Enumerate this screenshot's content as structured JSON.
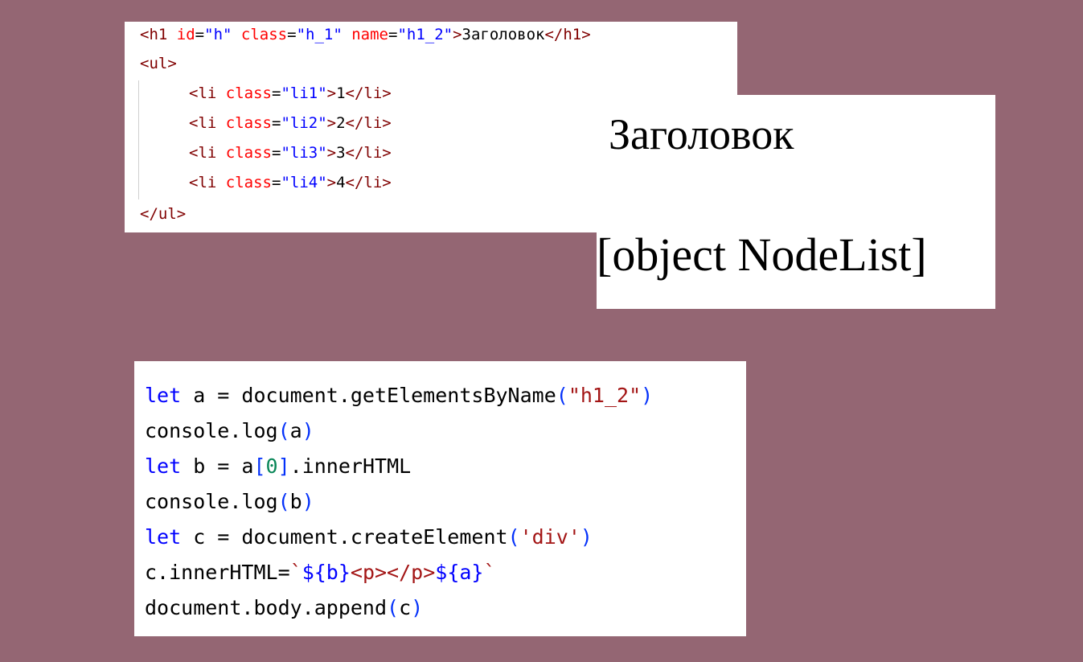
{
  "html_code": {
    "line1": {
      "open": "<h1",
      "attr_id": "id",
      "val_id": "\"h\"",
      "attr_class": "class",
      "val_class": "\"h_1\"",
      "attr_name": "name",
      "val_name": "\"h1_2\"",
      "gt": ">",
      "content": "Заголовок",
      "close": "</h1>"
    },
    "line2": "<ul>",
    "list_items": [
      {
        "open": "<li",
        "attr": "class",
        "value": "\"li1\"",
        "gt": ">",
        "content": "1",
        "close": "</li>"
      },
      {
        "open": "<li",
        "attr": "class",
        "value": "\"li2\"",
        "gt": ">",
        "content": "2",
        "close": "</li>"
      },
      {
        "open": "<li",
        "attr": "class",
        "value": "\"li3\"",
        "gt": ">",
        "content": "3",
        "close": "</li>"
      },
      {
        "open": "<li",
        "attr": "class",
        "value": "\"li4\"",
        "gt": ">",
        "content": "4",
        "close": "</li>"
      }
    ],
    "line_last": "</ul>"
  },
  "output": {
    "heading": "Заголовок",
    "text": "[object NodeList]"
  },
  "js_code": {
    "l1": {
      "kw": "let",
      "mid": " a = document.getElementsByName",
      "open": "(",
      "str": "\"h1_2\"",
      "close": ")"
    },
    "l2": {
      "pre": "console.log",
      "open": "(",
      "arg": "a",
      "close": ")"
    },
    "l3": {
      "kw": "let",
      "mid": " b = a",
      "open": "[",
      "num": "0",
      "close": "]",
      "post": ".innerHTML"
    },
    "l4": {
      "pre": "console.log",
      "open": "(",
      "arg": "b",
      "close": ")"
    },
    "l5": {
      "kw": "let",
      "mid": " c = document.createElement",
      "open": "(",
      "str": "'div'",
      "close": ")"
    },
    "l6": {
      "pre": "c.innerHTML=",
      "tick1": "`",
      "i1": "${b}",
      "mid": "<p></p>",
      "i2": "${a}",
      "tick2": "`"
    },
    "l7": {
      "pre": "document.body.append",
      "open": "(",
      "arg": "c",
      "close": ")"
    }
  },
  "colors": {
    "background": "#946673",
    "panel": "#ffffff",
    "html_tag": "#800000",
    "html_attr": "#ff0000",
    "html_value": "#0000ff",
    "js_keyword": "#0000ff",
    "js_string": "#a31515",
    "js_number": "#098658"
  }
}
